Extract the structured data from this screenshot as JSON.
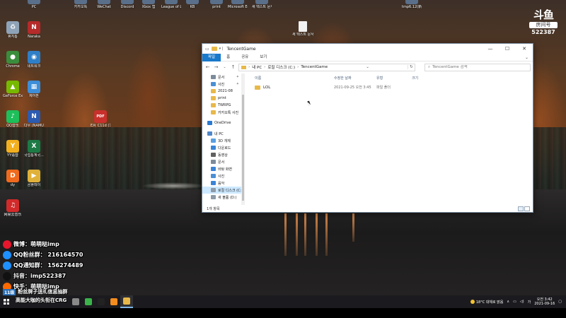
{
  "desktop_icons": [
    {
      "id": "di-recycle",
      "label": "휴지통",
      "icon": "recycle-bin-icon",
      "color": "#8fa3b8",
      "glyph": "♻"
    },
    {
      "id": "di-naraka",
      "label": "Naraka",
      "icon": "naraka-icon",
      "color": "#b52a2a",
      "glyph": "N"
    },
    {
      "id": "di-chrome",
      "label": "Chrome",
      "icon": "chrome-icon",
      "color": "#3a8d3c",
      "glyph": "●"
    },
    {
      "id": "di-network",
      "label": "네트워크",
      "icon": "network-icon",
      "color": "#2f7fc7",
      "glyph": "◉"
    },
    {
      "id": "di-geforce",
      "label": "GeForce Experience",
      "icon": "geforce-icon",
      "color": "#76b900",
      "glyph": "▲"
    },
    {
      "id": "di-control",
      "label": "제어판",
      "icon": "control-panel-icon",
      "color": "#3d8ed8",
      "glyph": "▦"
    },
    {
      "id": "di-qq",
      "label": "QQ音乐",
      "icon": "qq-music-icon",
      "color": "#1dbf5a",
      "glyph": "♪"
    },
    {
      "id": "di-naum",
      "label": "다우 (NAMUH)",
      "icon": "namuh-icon",
      "color": "#2c5bb0",
      "glyph": "N"
    },
    {
      "id": "di-pdf",
      "label": "E片 C11d (1)",
      "icon": "pdf-icon",
      "color": "#c9302c",
      "glyph": "PDF"
    },
    {
      "id": "di-yy",
      "label": "YY语音",
      "icon": "yy-voice-icon",
      "color": "#f2b01e",
      "glyph": "Y"
    },
    {
      "id": "di-excel",
      "label": "국립통계국...",
      "icon": "excel-icon",
      "color": "#1d7a44",
      "glyph": "X"
    },
    {
      "id": "di-dy",
      "label": "dy",
      "icon": "douyu-icon",
      "color": "#f06a1d",
      "glyph": "D"
    },
    {
      "id": "di-kakao",
      "label": "곰플레이",
      "icon": "gom-player-icon",
      "color": "#e0b13a",
      "glyph": "▶"
    },
    {
      "id": "di-netease",
      "label": "网易云音乐",
      "icon": "netease-music-icon",
      "color": "#d22a2a",
      "glyph": "♫"
    }
  ],
  "top_icons": [
    {
      "id": "ti-pc",
      "label": "PC"
    },
    {
      "id": "ti-kakao",
      "label": "카카오톡"
    },
    {
      "id": "ti-wechat",
      "label": "WeChat"
    },
    {
      "id": "ti-discord",
      "label": "Discord"
    },
    {
      "id": "ti-xbox",
      "label": "Xbox 앱"
    },
    {
      "id": "ti-lol",
      "label": "League of Legends"
    },
    {
      "id": "ti-kb",
      "label": "KB"
    },
    {
      "id": "ti-print",
      "label": "print"
    },
    {
      "id": "ti-edge",
      "label": "Microsoft Edge"
    },
    {
      "id": "ti-doc",
      "label": "새 텍스트 문서"
    },
    {
      "id": "ti-tmp",
      "label": "tmp6.12(新)"
    }
  ],
  "desktop_file": {
    "label": "새 텍스트 문서 (2)"
  },
  "overlay": {
    "logo_mark": "斗鱼",
    "logo_sub": "房间号",
    "room_number": "522387",
    "lines": [
      {
        "icon": "weibo-icon",
        "color": "#e6162d",
        "text": "微博：萌萌哒imp"
      },
      {
        "icon": "qq-fans-icon",
        "color": "#1e90ff",
        "text": "QQ粉丝群： 216164570"
      },
      {
        "icon": "qq-notice-icon",
        "color": "#1e90ff",
        "text": "QQ通知群： 156274489"
      },
      {
        "icon": "douyin-icon",
        "color": "#111111",
        "text": "抖音：imp522387"
      },
      {
        "icon": "kuaishou-icon",
        "color": "#ff6a00",
        "text": "快手：萌萌哒imp"
      }
    ],
    "tag_badge": "11级",
    "tag_text": "粉丝牌子送礼信息抽群",
    "tag_text_2": "高能大咖的头衔在CRG"
  },
  "explorer": {
    "window_title": "TencentGame",
    "title_prefix": "▾ |",
    "controls": {
      "minimize": "—",
      "maximize": "☐",
      "close": "✕"
    },
    "ribbon_tabs": [
      "파일",
      "홈",
      "공유",
      "보기"
    ],
    "address_parts": [
      "내 PC",
      "로컬 디스크 (C:)",
      "TencentGame"
    ],
    "search_placeholder": "TencentGame 검색",
    "nav_items": [
      {
        "label": "문서",
        "icon": "documents-icon",
        "color": "#7c8b9c",
        "pinned": true
      },
      {
        "label": "사진",
        "icon": "pictures-icon",
        "color": "#4b8fd4",
        "pinned": true
      },
      {
        "label": "2021-08",
        "icon": "folder-icon",
        "color": "#e8b94a"
      },
      {
        "label": "print",
        "icon": "folder-icon",
        "color": "#e8b94a"
      },
      {
        "label": "TWRPG",
        "icon": "folder-icon",
        "color": "#e8b94a"
      },
      {
        "label": "카카오톡 사진",
        "icon": "folder-icon",
        "color": "#e8b94a"
      },
      {
        "label": "OneDrive",
        "icon": "onedrive-icon",
        "color": "#2b79d0",
        "gap": true,
        "top": true
      },
      {
        "label": "내 PC",
        "icon": "pc-icon",
        "color": "#4f87c9",
        "gap": true,
        "top": true
      },
      {
        "label": "3D 개체",
        "icon": "3d-objects-icon",
        "color": "#5aa0e0"
      },
      {
        "label": "다운로드",
        "icon": "downloads-icon",
        "color": "#3a84d6"
      },
      {
        "label": "동영상",
        "icon": "videos-icon",
        "color": "#606060"
      },
      {
        "label": "문서",
        "icon": "documents-icon",
        "color": "#7c8b9c"
      },
      {
        "label": "바탕 화면",
        "icon": "desktop-icon",
        "color": "#3a84d6"
      },
      {
        "label": "사진",
        "icon": "pictures-icon",
        "color": "#4b8fd4"
      },
      {
        "label": "음악",
        "icon": "music-icon",
        "color": "#3a84d6"
      },
      {
        "label": "로컬 디스크 (C:)",
        "icon": "drive-icon",
        "color": "#8d9aa8",
        "selected": true
      },
      {
        "label": "새 볼륨 (D:)",
        "icon": "drive-icon",
        "color": "#8d9aa8"
      },
      {
        "label": "네트워크",
        "icon": "network-icon",
        "color": "#4f87c9",
        "gap": true,
        "top": true
      }
    ],
    "columns": [
      "이름",
      "수정한 날짜",
      "유형",
      "크기"
    ],
    "files": [
      {
        "name": "LOL",
        "modified": "2021-09-25 오전 3:45",
        "type": "파일 폴더",
        "size": ""
      }
    ],
    "status": "1개 항목"
  },
  "taskbar": {
    "apps": [
      {
        "icon": "search-app-icon",
        "color": "#888888"
      },
      {
        "icon": "green-app-icon",
        "color": "#3bb34a"
      },
      {
        "icon": "terminal-icon",
        "color": "#222222"
      },
      {
        "icon": "orange-app-icon",
        "color": "#f28c1e"
      },
      {
        "icon": "file-explorer-icon",
        "color": "#e8b94a",
        "active": true
      }
    ],
    "weather": "18°C 대체로 맑음",
    "ime": "가",
    "time": "오전 3:42",
    "date": "2021-09-16"
  }
}
